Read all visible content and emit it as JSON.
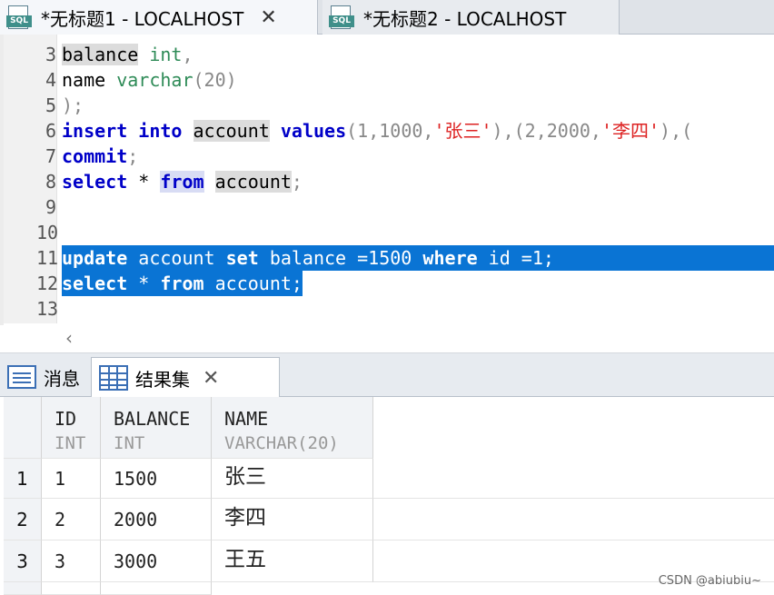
{
  "tabs": [
    {
      "title": "*无标题1 - LOCALHOST",
      "close": "✕"
    },
    {
      "title": "*无标题2 - LOCALHOST"
    }
  ],
  "editor": {
    "lines": [
      {
        "n": "3"
      },
      {
        "n": "4"
      },
      {
        "n": "5"
      },
      {
        "n": "6"
      },
      {
        "n": "7"
      },
      {
        "n": "8"
      },
      {
        "n": "9"
      },
      {
        "n": "10"
      },
      {
        "n": "11"
      },
      {
        "n": "12"
      },
      {
        "n": "13"
      }
    ],
    "tokens": {
      "balance": "balance",
      "int": "int",
      "comma": ",",
      "name": "name",
      "varchar": "varchar",
      "varchar_len": "(20)",
      "close_paren": ");",
      "insert": "insert",
      "into": "into",
      "account": "account",
      "values": "values",
      "values_p1": "(1,1000,",
      "str1": "'张三'",
      "values_p2": "),(2,2000,",
      "str2": "'李四'",
      "values_p3": "),(",
      "commit": "commit",
      "semi": ";",
      "select": "select",
      "star": "*",
      "from": "from",
      "update_kw": "update",
      "set_kw": "set",
      "where_kw": "where",
      "update_rest1": "account",
      "update_rest2": "balance =1500",
      "update_rest3": "id =1;",
      "select2_rest": "account;"
    },
    "scroll_arrow": "‹"
  },
  "result_tabs": {
    "messages": "消息",
    "resultset": "结果集",
    "close": "✕"
  },
  "grid": {
    "columns": [
      {
        "name": "ID",
        "type": "INT"
      },
      {
        "name": "BALANCE",
        "type": "INT"
      },
      {
        "name": "NAME",
        "type": "VARCHAR(20)"
      }
    ],
    "rows": [
      {
        "num": "1",
        "id": "1",
        "balance": "1500",
        "name": "张三"
      },
      {
        "num": "2",
        "id": "2",
        "balance": "2000",
        "name": "李四"
      },
      {
        "num": "3",
        "id": "3",
        "balance": "3000",
        "name": "王五"
      }
    ]
  },
  "watermark": "CSDN @abiubiu~"
}
